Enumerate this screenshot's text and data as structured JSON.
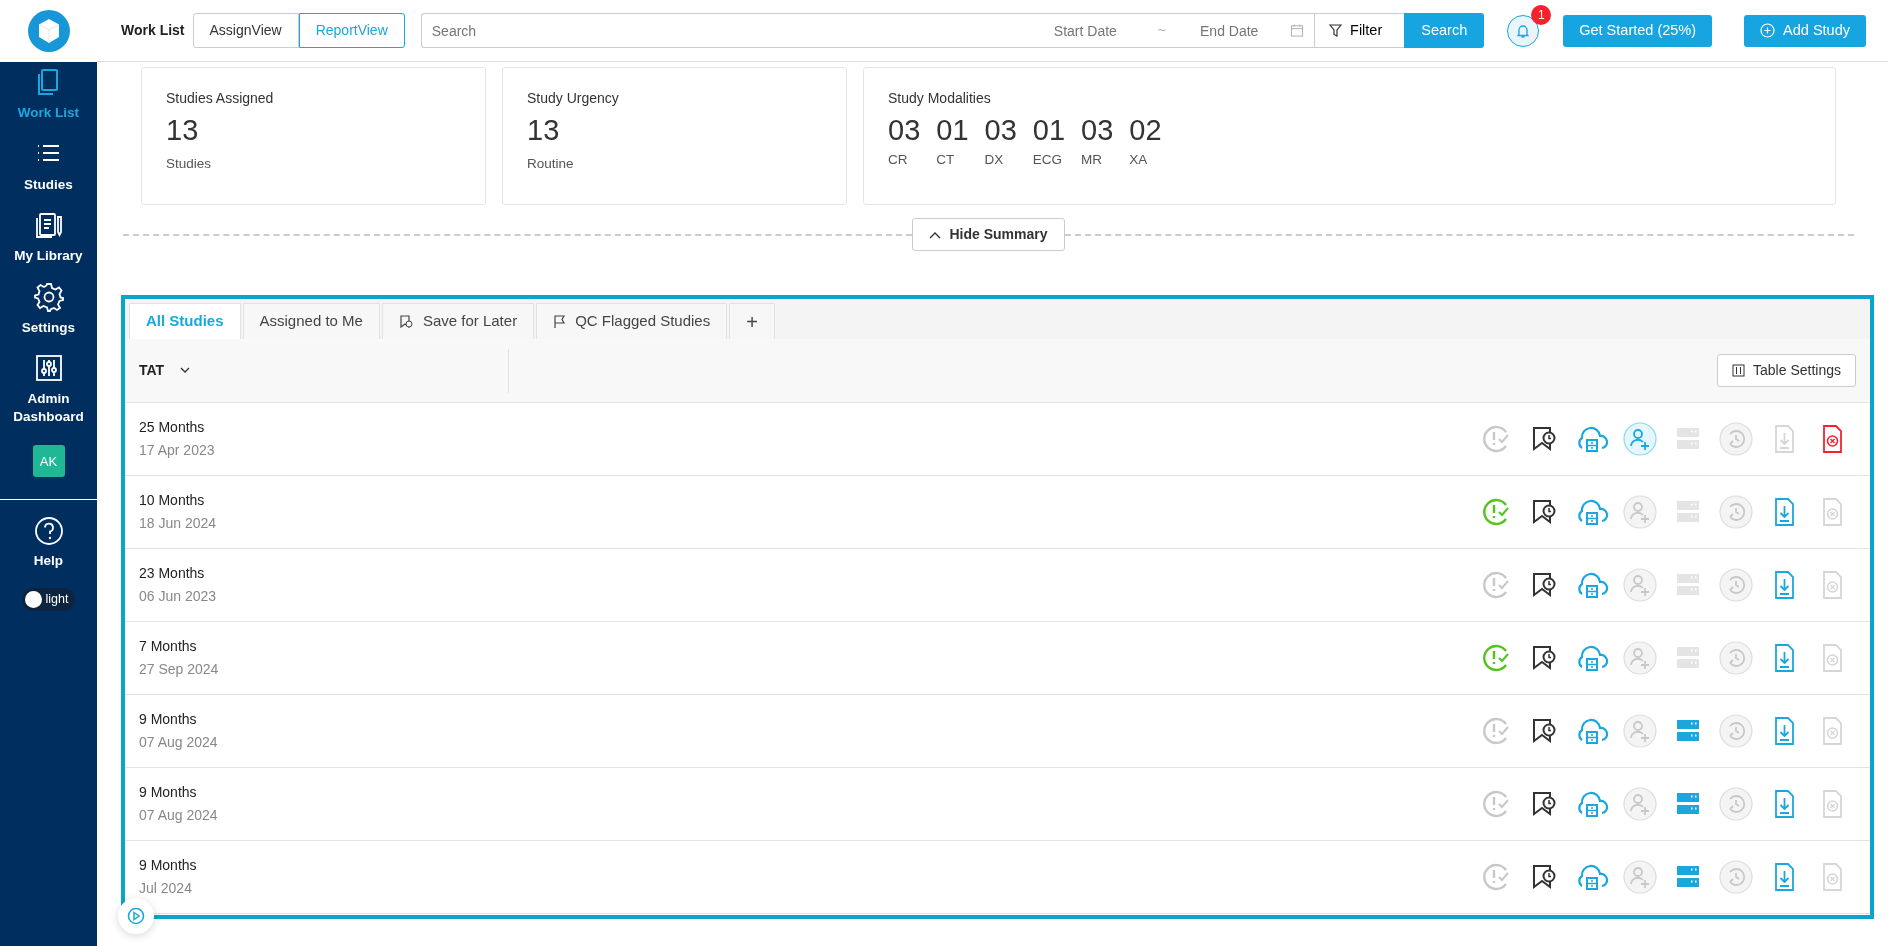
{
  "sidebar": {
    "items": [
      {
        "label": "Work List",
        "selected": true
      },
      {
        "label": "Studies",
        "selected": false
      },
      {
        "label": "My Library",
        "selected": false
      },
      {
        "label": "Settings",
        "selected": false
      },
      {
        "label": "Admin Dashboard",
        "selected": false
      }
    ],
    "avatar": "AK",
    "help": "Help",
    "theme_toggle": {
      "label": "light",
      "on": false
    }
  },
  "topbar": {
    "title": "Work List",
    "views": [
      {
        "label": "AssignView",
        "selected": false
      },
      {
        "label": "ReportView",
        "selected": true
      }
    ],
    "search": {
      "placeholder": "Search"
    },
    "start_date": {
      "placeholder": "Start Date"
    },
    "separator": "~",
    "end_date": {
      "placeholder": "End Date"
    },
    "filter": "Filter",
    "search_button": "Search",
    "notifications": "1",
    "get_started": "Get Started (25%)",
    "add_study": "Add Study"
  },
  "summary": [
    {
      "kind": "single",
      "title": "Studies Assigned",
      "value": "13",
      "caption": "Studies"
    },
    {
      "kind": "single",
      "title": "Study Urgency",
      "value": "13",
      "caption": "Routine"
    },
    {
      "kind": "modalities",
      "title": "Study Modalities",
      "items": [
        {
          "value": "03",
          "caption": "CR"
        },
        {
          "value": "01",
          "caption": "CT"
        },
        {
          "value": "03",
          "caption": "DX"
        },
        {
          "value": "01",
          "caption": "ECG"
        },
        {
          "value": "03",
          "caption": "MR"
        },
        {
          "value": "02",
          "caption": "XA"
        }
      ]
    }
  ],
  "hide_summary": "Hide Summary",
  "tabs": [
    {
      "label": "All Studies",
      "kind": "plain",
      "selected": true
    },
    {
      "label": "Assigned to Me",
      "kind": "plain",
      "selected": false
    },
    {
      "label": "Save for Later",
      "kind": "bookmark",
      "selected": false
    },
    {
      "label": "QC Flagged Studies",
      "kind": "flag",
      "selected": false
    },
    {
      "label": "+",
      "kind": "add",
      "selected": false
    }
  ],
  "table": {
    "column": "TAT",
    "table_settings": "Table Settings",
    "rows": [
      {
        "tat": "25 Months",
        "date": "17 Apr 2023",
        "tat_met": false,
        "assign_active": true,
        "server_active": false,
        "report_ready": false,
        "cancel_active": true
      },
      {
        "tat": "10 Months",
        "date": "18 Jun 2024",
        "tat_met": true,
        "assign_active": false,
        "server_active": false,
        "report_ready": true,
        "cancel_active": false
      },
      {
        "tat": "23 Months",
        "date": "06 Jun 2023",
        "tat_met": false,
        "assign_active": false,
        "server_active": false,
        "report_ready": true,
        "cancel_active": false
      },
      {
        "tat": "7 Months",
        "date": "27 Sep 2024",
        "tat_met": true,
        "assign_active": false,
        "server_active": false,
        "report_ready": true,
        "cancel_active": false
      },
      {
        "tat": "9 Months",
        "date": "07 Aug 2024",
        "tat_met": false,
        "assign_active": false,
        "server_active": true,
        "report_ready": true,
        "cancel_active": false
      },
      {
        "tat": "9 Months",
        "date": "07 Aug 2024",
        "tat_met": false,
        "assign_active": false,
        "server_active": true,
        "report_ready": true,
        "cancel_active": false
      },
      {
        "tat": "9 Months",
        "date": "Jul 2024",
        "tat_met": false,
        "assign_active": false,
        "server_active": true,
        "report_ready": true,
        "cancel_active": false
      }
    ]
  }
}
